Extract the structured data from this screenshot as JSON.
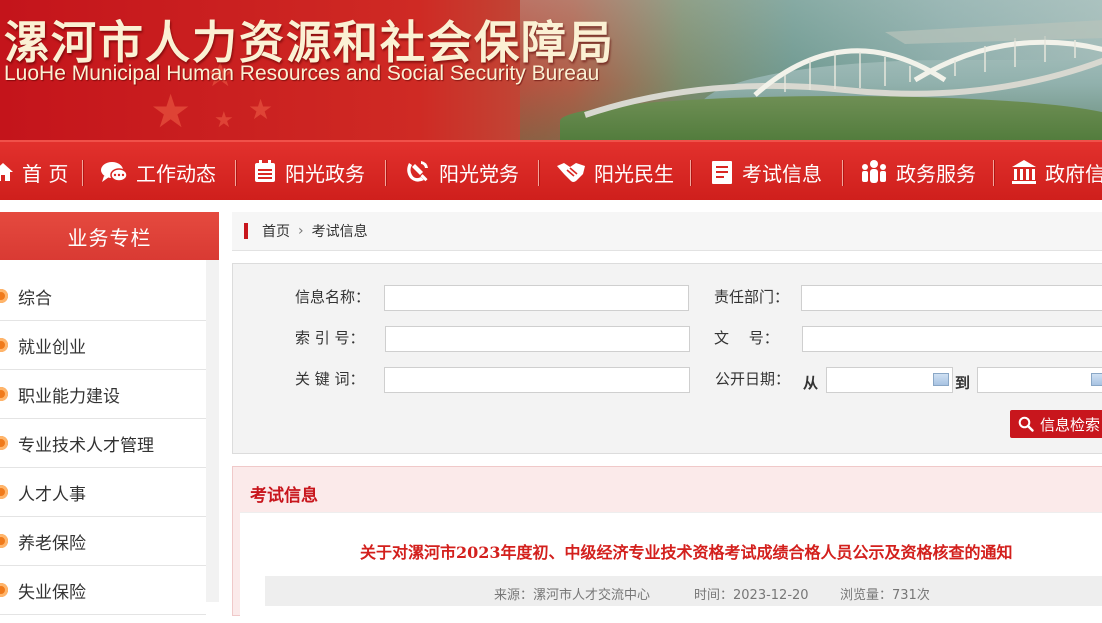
{
  "banner": {
    "title_cn": "漯河市人力资源和社会保障局",
    "title_en": "LuoHe Municipal Human Resources and Social Security Bureau"
  },
  "nav": {
    "items": [
      {
        "label": "首 页",
        "icon": "home-icon"
      },
      {
        "label": "工作动态",
        "icon": "chat-bubble-icon"
      },
      {
        "label": "阳光政务",
        "icon": "document-list-icon"
      },
      {
        "label": "阳光党务",
        "icon": "party-emblem-icon"
      },
      {
        "label": "阳光民生",
        "icon": "handshake-icon"
      },
      {
        "label": "考试信息",
        "icon": "exam-form-icon"
      },
      {
        "label": "政务服务",
        "icon": "people-icon"
      },
      {
        "label": "政府信",
        "icon": "government-building-icon"
      }
    ]
  },
  "sidebar": {
    "title": "业务专栏",
    "items": [
      "综合",
      "就业创业",
      "职业能力建设",
      "专业技术人才管理",
      "人才人事",
      "养老保险",
      "失业保险"
    ]
  },
  "breadcrumb": {
    "home": "首页",
    "separator": "›",
    "current": "考试信息"
  },
  "search": {
    "name_label": "信息名称：",
    "dept_label": "责任部门：",
    "index_label": "索 引 号：",
    "doc_label": "文　 号：",
    "keyword_label": "关 键 词：",
    "date_label": "公开日期：",
    "from_label": "从",
    "to_label": "到",
    "button_label": "信息检索",
    "name_value": "",
    "dept_value": "",
    "index_value": "",
    "doc_value": "",
    "keyword_value": "",
    "date_from_value": "",
    "date_to_value": ""
  },
  "list": {
    "title": "考试信息",
    "article": {
      "title": "关于对漯河市2023年度初、中级经济专业技术资格考试成绩合格人员公示及资格核查的通知",
      "source": "来源：漯河市人才交流中心",
      "time": "时间：2023-12-20",
      "views": "浏览量：731次"
    }
  },
  "colors": {
    "brand_red": "#c8161d",
    "nav_red": "#d92722",
    "accent_orange": "#f07a1b"
  }
}
